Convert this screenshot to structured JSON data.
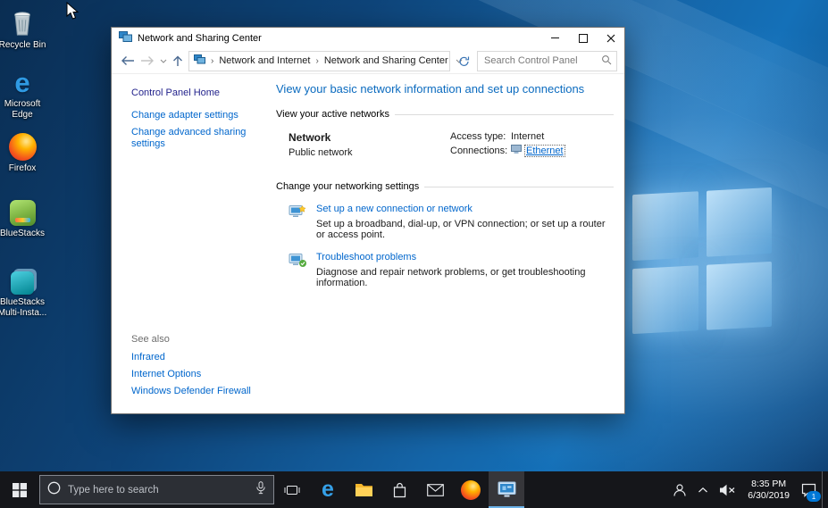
{
  "desktop": {
    "icons": [
      {
        "label": "Recycle Bin"
      },
      {
        "label": "Microsoft Edge"
      },
      {
        "label": "Firefox"
      },
      {
        "label": "BlueStacks"
      },
      {
        "label": "BlueStacks Multi-Insta..."
      }
    ],
    "edge_glyph": "e"
  },
  "window": {
    "title": "Network and Sharing Center",
    "nav": {
      "crumb1": "Network and Internet",
      "crumb2": "Network and Sharing Center",
      "separator": "›",
      "search_placeholder": "Search Control Panel"
    },
    "sidebar": {
      "home": "Control Panel Home",
      "link1": "Change adapter settings",
      "link2": "Change advanced sharing settings",
      "see_also": "See also",
      "see1": "Infrared",
      "see2": "Internet Options",
      "see3": "Windows Defender Firewall"
    },
    "main": {
      "heading": "View your basic network information and set up connections",
      "active_header": "View your active networks",
      "network_name": "Network",
      "network_type": "Public network",
      "access_label": "Access type:",
      "access_value": "Internet",
      "conn_label": "Connections:",
      "conn_value": "Ethernet",
      "settings_header": "Change your networking settings",
      "setup_title": "Set up a new connection or network",
      "setup_desc": "Set up a broadband, dial-up, or VPN connection; or set up a router or access point.",
      "ts_title": "Troubleshoot problems",
      "ts_desc": "Diagnose and repair network problems, or get troubleshooting information."
    }
  },
  "taskbar": {
    "search_placeholder": "Type here to search",
    "edge_glyph": "e",
    "clock_time": "8:35 PM",
    "clock_date": "6/30/2019",
    "notification_count": "1"
  },
  "colors": {
    "link_blue": "#0066cc",
    "heading_blue": "#0b6bbf",
    "accent": "#0078d7",
    "taskbar_bg": "#15161a"
  }
}
